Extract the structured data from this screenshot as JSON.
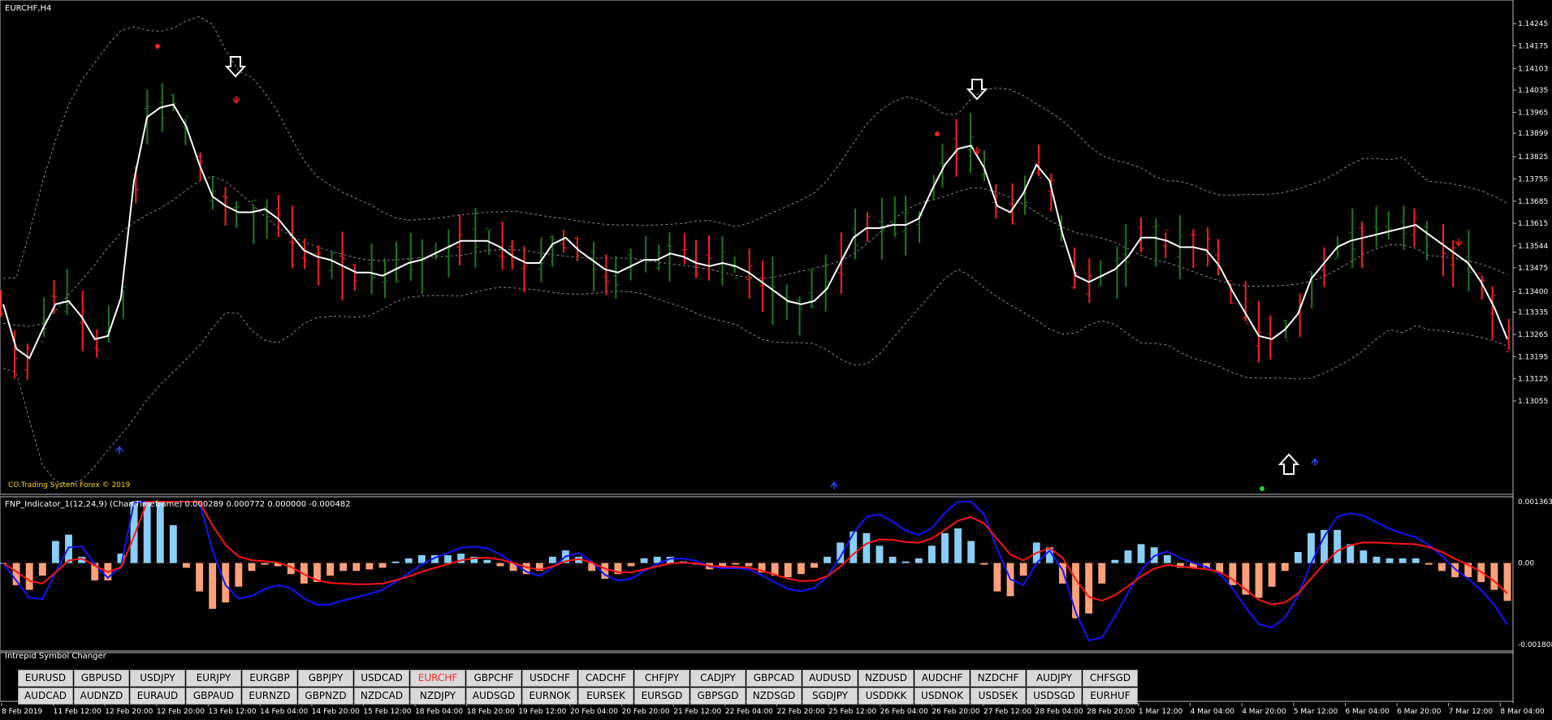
{
  "window": {
    "title": "EURCHF,H4",
    "watermark": "CO.Trading System Forex © 2019"
  },
  "indicator": {
    "title": "FNP_Indicator_1(12,24,9) (ChartTimeframe) 0.000289 0.000772 0.000000 -0.000482"
  },
  "symbol_changer": {
    "title": "Intrepid Symbol Changer",
    "active": "EURCHF",
    "row1": [
      "EURUSD",
      "GBPUSD",
      "USDJPY",
      "EURJPY",
      "EURGBP",
      "GBPJPY",
      "USDCAD",
      "EURCHF",
      "GBPCHF",
      "USDCHF",
      "CADCHF",
      "CHFJPY",
      "CADJPY",
      "GBPCAD",
      "AUDUSD",
      "NZDUSD",
      "AUDCHF",
      "NZDCHF",
      "AUDJPY",
      "CHFSGD"
    ],
    "row2": [
      "AUDCAD",
      "AUDNZD",
      "EURAUD",
      "GBPAUD",
      "EURNZD",
      "GBPNZD",
      "NZDCAD",
      "NZDJPY",
      "AUDSGD",
      "EURNOK",
      "EURSEK",
      "EURSGD",
      "GBPSGD",
      "NZDSGD",
      "SGDJPY",
      "USDDKK",
      "USDNOK",
      "USDSEK",
      "USDSGD",
      "EURHUF"
    ]
  },
  "colors": {
    "bull": "#1f7a1f",
    "bear": "#ff2020",
    "ma": "#ffffff",
    "band": "#8c8c8c",
    "hist_pos": "#87cefa",
    "hist_neg": "#ffa07a",
    "line_blue": "#1515ff",
    "line_red": "#ff1414"
  },
  "chart_data": [
    {
      "type": "line",
      "title": "EURCHF,H4",
      "ylim": [
        1.13055,
        1.1428
      ],
      "y_ticks": [
        "1.14245",
        "1.14175",
        "1.14103",
        "1.14035",
        "1.13965",
        "1.13899",
        "1.13825",
        "1.13755",
        "1.13685",
        "1.13615",
        "1.13544",
        "1.13475",
        "1.13400",
        "1.13335",
        "1.13265",
        "1.13195",
        "1.13125",
        "1.13055"
      ],
      "x_labels": [
        "8 Feb 2019",
        "11 Feb 12:00",
        "12 Feb 20:00",
        "12 Feb 20:00",
        "13 Feb 12:00",
        "14 Feb 04:00",
        "14 Feb 20:00",
        "15 Feb 12:00",
        "18 Feb 04:00",
        "18 Feb 20:00",
        "19 Feb 12:00",
        "20 Feb 04:00",
        "20 Feb 20:00",
        "21 Feb 12:00",
        "22 Feb 04:00",
        "22 Feb 20:00",
        "25 Feb 12:00",
        "26 Feb 04:00",
        "26 Feb 20:00",
        "27 Feb 12:00",
        "28 Feb 04:00",
        "28 Feb 20:00",
        "1 Mar 12:00",
        "4 Mar 04:00",
        "4 Mar 20:00",
        "5 Mar 12:00",
        "6 Mar 04:00",
        "6 Mar 20:00",
        "7 Mar 12:00",
        "8 Mar 04:00"
      ],
      "series": [
        {
          "values": [
            1.1336,
            1.1322,
            1.1319,
            1.1328,
            1.1336,
            1.1337,
            1.1332,
            1.1325,
            1.1326,
            1.1338,
            1.1375,
            1.1395,
            1.1398,
            1.1399,
            1.1392,
            1.138,
            1.137,
            1.1367,
            1.1365,
            1.1365,
            1.1366,
            1.1363,
            1.1358,
            1.1353,
            1.1351,
            1.135,
            1.1348,
            1.1346,
            1.1346,
            1.1345,
            1.1347,
            1.1349,
            1.135,
            1.1352,
            1.1354,
            1.1356,
            1.1356,
            1.1356,
            1.1354,
            1.1351,
            1.1349,
            1.1349,
            1.1355,
            1.1357,
            1.1353,
            1.135,
            1.1347,
            1.1346,
            1.1348,
            1.135,
            1.135,
            1.1352,
            1.1351,
            1.1349,
            1.1348,
            1.1349,
            1.1348,
            1.1346,
            1.1343,
            1.134,
            1.1337,
            1.1336,
            1.1337,
            1.1341,
            1.1349,
            1.1357,
            1.136,
            1.136,
            1.1361,
            1.1361,
            1.1363,
            1.1372,
            1.138,
            1.1385,
            1.1386,
            1.1379,
            1.1367,
            1.1365,
            1.1371,
            1.138,
            1.1375,
            1.1358,
            1.1345,
            1.1343,
            1.1345,
            1.1347,
            1.1351,
            1.1357,
            1.1357,
            1.1356,
            1.1354,
            1.1354,
            1.1353,
            1.1348,
            1.134,
            1.1333,
            1.1326,
            1.1325,
            1.1328,
            1.1333,
            1.1344,
            1.1349,
            1.1354,
            1.1356,
            1.1357,
            1.1358,
            1.1359,
            1.136,
            1.1361,
            1.1358,
            1.1355,
            1.1352,
            1.1349,
            1.1343,
            1.1335,
            1.1325
          ]
        }
      ]
    },
    {
      "type": "bar",
      "title": "FNP_Indicator_1(12,24,9) (ChartTimeframe)",
      "ylim": [
        -0.001808,
        0.001363
      ],
      "y_ticks": [
        "0.001363",
        "0.00",
        "-0.001808"
      ]
    }
  ]
}
